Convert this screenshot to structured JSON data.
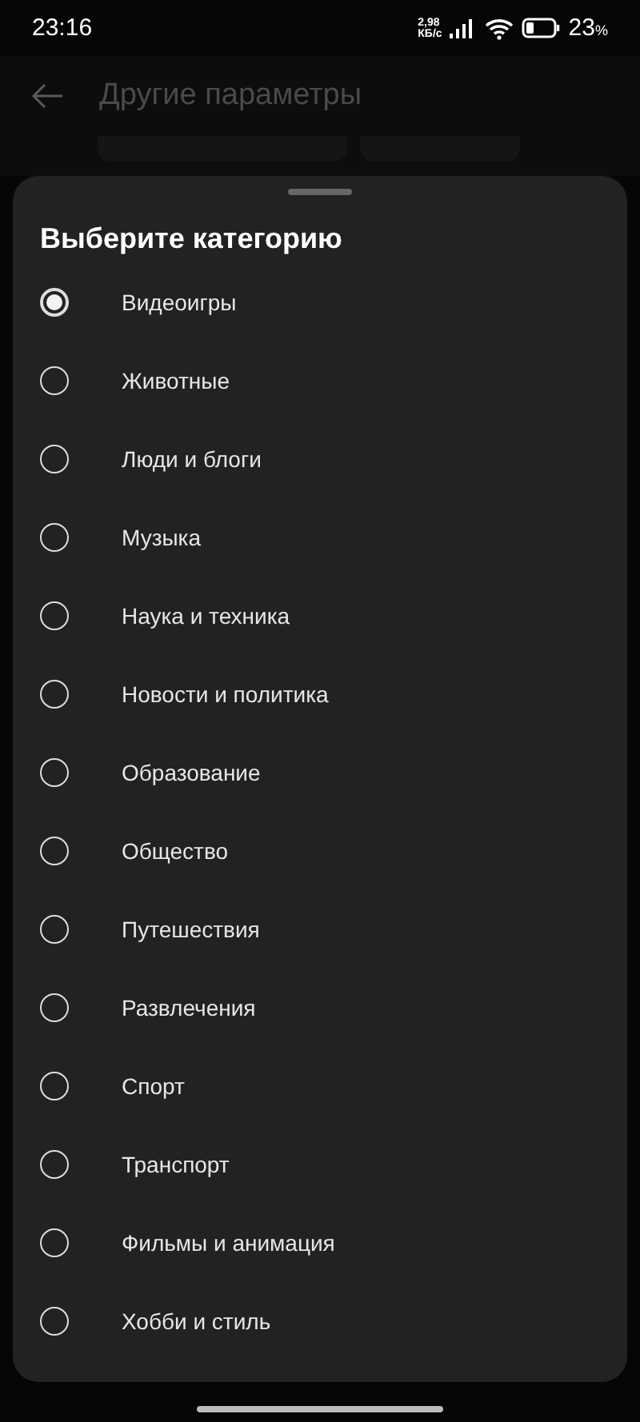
{
  "status_bar": {
    "time": "23:16",
    "speed": "2,98",
    "speed_unit": "КБ/с",
    "battery": "23",
    "battery_unit": "%"
  },
  "header": {
    "title": "Другие параметры"
  },
  "sheet": {
    "title": "Выберите категорию",
    "options": [
      {
        "label": "Видеоигры",
        "selected": true
      },
      {
        "label": "Животные",
        "selected": false
      },
      {
        "label": "Люди и блоги",
        "selected": false
      },
      {
        "label": "Музыка",
        "selected": false
      },
      {
        "label": "Наука и техника",
        "selected": false
      },
      {
        "label": "Новости и политика",
        "selected": false
      },
      {
        "label": "Образование",
        "selected": false
      },
      {
        "label": "Общество",
        "selected": false
      },
      {
        "label": "Путешествия",
        "selected": false
      },
      {
        "label": "Развлечения",
        "selected": false
      },
      {
        "label": "Спорт",
        "selected": false
      },
      {
        "label": "Транспорт",
        "selected": false
      },
      {
        "label": "Фильмы и анимация",
        "selected": false
      },
      {
        "label": "Хобби и стиль",
        "selected": false
      }
    ]
  }
}
